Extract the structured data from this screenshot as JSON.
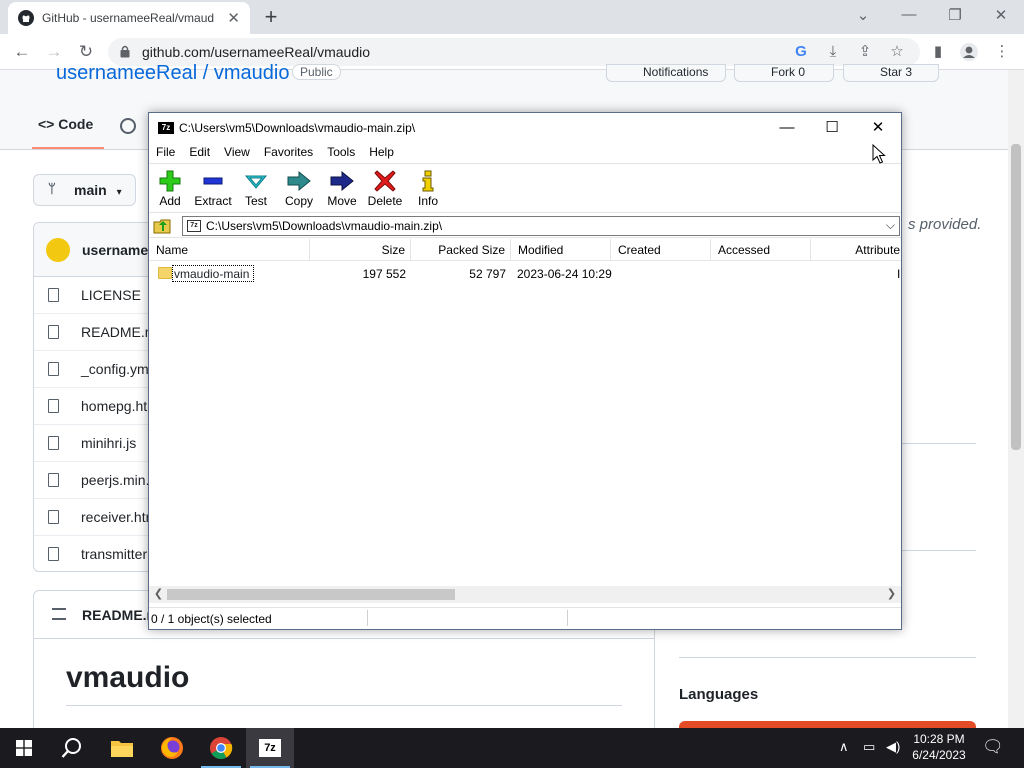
{
  "browser": {
    "tab_title": "GitHub - usernameeReal/vmaudio",
    "url": "github.com/usernameeReal/vmaudio"
  },
  "github": {
    "repo_path": "usernameeReal / vmaudio",
    "visibility": "Public",
    "notifications_label": "Notifications",
    "fork_label": "Fork",
    "fork_count": "0",
    "star_label": "Star",
    "star_count": "3",
    "code_tab": "Code",
    "branch": "main",
    "commit_user": "usernamee",
    "files": [
      "LICENSE",
      "README.m",
      "_config.ym",
      "homepg.ht",
      "minihri.js",
      "peerjs.min.",
      "receiver.htr",
      "transmitter"
    ],
    "readme_label": "README.m",
    "readme_heading": "vmaudio",
    "about_text": "s provided.",
    "languages_label": "Languages",
    "lang_color": "#e34c26"
  },
  "sevenzip": {
    "title": "C:\\Users\\vm5\\Downloads\\vmaudio-main.zip\\",
    "menu": [
      "File",
      "Edit",
      "View",
      "Favorites",
      "Tools",
      "Help"
    ],
    "tools": {
      "add": "Add",
      "extract": "Extract",
      "test": "Test",
      "copy": "Copy",
      "move": "Move",
      "delete": "Delete",
      "info": "Info"
    },
    "path": "C:\\Users\\vm5\\Downloads\\vmaudio-main.zip\\",
    "columns": {
      "name": "Name",
      "size": "Size",
      "packed": "Packed Size",
      "modified": "Modified",
      "created": "Created",
      "accessed": "Accessed",
      "attributes": "Attribute"
    },
    "rows": [
      {
        "name": "vmaudio-main",
        "size": "197 552",
        "packed": "52 797",
        "modified": "2023-06-24 10:29",
        "attr": "I"
      }
    ],
    "status": "0 / 1 object(s) selected"
  },
  "taskbar": {
    "time": "10:28 PM",
    "date": "6/24/2023"
  }
}
